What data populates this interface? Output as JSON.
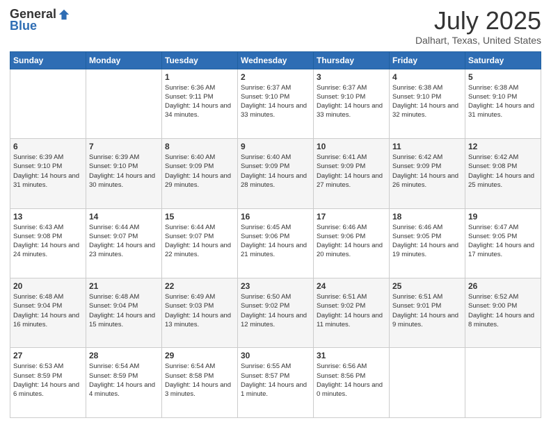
{
  "header": {
    "logo_general": "General",
    "logo_blue": "Blue",
    "title": "July 2025",
    "location": "Dalhart, Texas, United States"
  },
  "days_of_week": [
    "Sunday",
    "Monday",
    "Tuesday",
    "Wednesday",
    "Thursday",
    "Friday",
    "Saturday"
  ],
  "weeks": [
    [
      {
        "day": "",
        "sunrise": "",
        "sunset": "",
        "daylight": ""
      },
      {
        "day": "",
        "sunrise": "",
        "sunset": "",
        "daylight": ""
      },
      {
        "day": "1",
        "sunrise": "Sunrise: 6:36 AM",
        "sunset": "Sunset: 9:11 PM",
        "daylight": "Daylight: 14 hours and 34 minutes."
      },
      {
        "day": "2",
        "sunrise": "Sunrise: 6:37 AM",
        "sunset": "Sunset: 9:10 PM",
        "daylight": "Daylight: 14 hours and 33 minutes."
      },
      {
        "day": "3",
        "sunrise": "Sunrise: 6:37 AM",
        "sunset": "Sunset: 9:10 PM",
        "daylight": "Daylight: 14 hours and 33 minutes."
      },
      {
        "day": "4",
        "sunrise": "Sunrise: 6:38 AM",
        "sunset": "Sunset: 9:10 PM",
        "daylight": "Daylight: 14 hours and 32 minutes."
      },
      {
        "day": "5",
        "sunrise": "Sunrise: 6:38 AM",
        "sunset": "Sunset: 9:10 PM",
        "daylight": "Daylight: 14 hours and 31 minutes."
      }
    ],
    [
      {
        "day": "6",
        "sunrise": "Sunrise: 6:39 AM",
        "sunset": "Sunset: 9:10 PM",
        "daylight": "Daylight: 14 hours and 31 minutes."
      },
      {
        "day": "7",
        "sunrise": "Sunrise: 6:39 AM",
        "sunset": "Sunset: 9:10 PM",
        "daylight": "Daylight: 14 hours and 30 minutes."
      },
      {
        "day": "8",
        "sunrise": "Sunrise: 6:40 AM",
        "sunset": "Sunset: 9:09 PM",
        "daylight": "Daylight: 14 hours and 29 minutes."
      },
      {
        "day": "9",
        "sunrise": "Sunrise: 6:40 AM",
        "sunset": "Sunset: 9:09 PM",
        "daylight": "Daylight: 14 hours and 28 minutes."
      },
      {
        "day": "10",
        "sunrise": "Sunrise: 6:41 AM",
        "sunset": "Sunset: 9:09 PM",
        "daylight": "Daylight: 14 hours and 27 minutes."
      },
      {
        "day": "11",
        "sunrise": "Sunrise: 6:42 AM",
        "sunset": "Sunset: 9:09 PM",
        "daylight": "Daylight: 14 hours and 26 minutes."
      },
      {
        "day": "12",
        "sunrise": "Sunrise: 6:42 AM",
        "sunset": "Sunset: 9:08 PM",
        "daylight": "Daylight: 14 hours and 25 minutes."
      }
    ],
    [
      {
        "day": "13",
        "sunrise": "Sunrise: 6:43 AM",
        "sunset": "Sunset: 9:08 PM",
        "daylight": "Daylight: 14 hours and 24 minutes."
      },
      {
        "day": "14",
        "sunrise": "Sunrise: 6:44 AM",
        "sunset": "Sunset: 9:07 PM",
        "daylight": "Daylight: 14 hours and 23 minutes."
      },
      {
        "day": "15",
        "sunrise": "Sunrise: 6:44 AM",
        "sunset": "Sunset: 9:07 PM",
        "daylight": "Daylight: 14 hours and 22 minutes."
      },
      {
        "day": "16",
        "sunrise": "Sunrise: 6:45 AM",
        "sunset": "Sunset: 9:06 PM",
        "daylight": "Daylight: 14 hours and 21 minutes."
      },
      {
        "day": "17",
        "sunrise": "Sunrise: 6:46 AM",
        "sunset": "Sunset: 9:06 PM",
        "daylight": "Daylight: 14 hours and 20 minutes."
      },
      {
        "day": "18",
        "sunrise": "Sunrise: 6:46 AM",
        "sunset": "Sunset: 9:05 PM",
        "daylight": "Daylight: 14 hours and 19 minutes."
      },
      {
        "day": "19",
        "sunrise": "Sunrise: 6:47 AM",
        "sunset": "Sunset: 9:05 PM",
        "daylight": "Daylight: 14 hours and 17 minutes."
      }
    ],
    [
      {
        "day": "20",
        "sunrise": "Sunrise: 6:48 AM",
        "sunset": "Sunset: 9:04 PM",
        "daylight": "Daylight: 14 hours and 16 minutes."
      },
      {
        "day": "21",
        "sunrise": "Sunrise: 6:48 AM",
        "sunset": "Sunset: 9:04 PM",
        "daylight": "Daylight: 14 hours and 15 minutes."
      },
      {
        "day": "22",
        "sunrise": "Sunrise: 6:49 AM",
        "sunset": "Sunset: 9:03 PM",
        "daylight": "Daylight: 14 hours and 13 minutes."
      },
      {
        "day": "23",
        "sunrise": "Sunrise: 6:50 AM",
        "sunset": "Sunset: 9:02 PM",
        "daylight": "Daylight: 14 hours and 12 minutes."
      },
      {
        "day": "24",
        "sunrise": "Sunrise: 6:51 AM",
        "sunset": "Sunset: 9:02 PM",
        "daylight": "Daylight: 14 hours and 11 minutes."
      },
      {
        "day": "25",
        "sunrise": "Sunrise: 6:51 AM",
        "sunset": "Sunset: 9:01 PM",
        "daylight": "Daylight: 14 hours and 9 minutes."
      },
      {
        "day": "26",
        "sunrise": "Sunrise: 6:52 AM",
        "sunset": "Sunset: 9:00 PM",
        "daylight": "Daylight: 14 hours and 8 minutes."
      }
    ],
    [
      {
        "day": "27",
        "sunrise": "Sunrise: 6:53 AM",
        "sunset": "Sunset: 8:59 PM",
        "daylight": "Daylight: 14 hours and 6 minutes."
      },
      {
        "day": "28",
        "sunrise": "Sunrise: 6:54 AM",
        "sunset": "Sunset: 8:59 PM",
        "daylight": "Daylight: 14 hours and 4 minutes."
      },
      {
        "day": "29",
        "sunrise": "Sunrise: 6:54 AM",
        "sunset": "Sunset: 8:58 PM",
        "daylight": "Daylight: 14 hours and 3 minutes."
      },
      {
        "day": "30",
        "sunrise": "Sunrise: 6:55 AM",
        "sunset": "Sunset: 8:57 PM",
        "daylight": "Daylight: 14 hours and 1 minute."
      },
      {
        "day": "31",
        "sunrise": "Sunrise: 6:56 AM",
        "sunset": "Sunset: 8:56 PM",
        "daylight": "Daylight: 14 hours and 0 minutes."
      },
      {
        "day": "",
        "sunrise": "",
        "sunset": "",
        "daylight": ""
      },
      {
        "day": "",
        "sunrise": "",
        "sunset": "",
        "daylight": ""
      }
    ]
  ]
}
